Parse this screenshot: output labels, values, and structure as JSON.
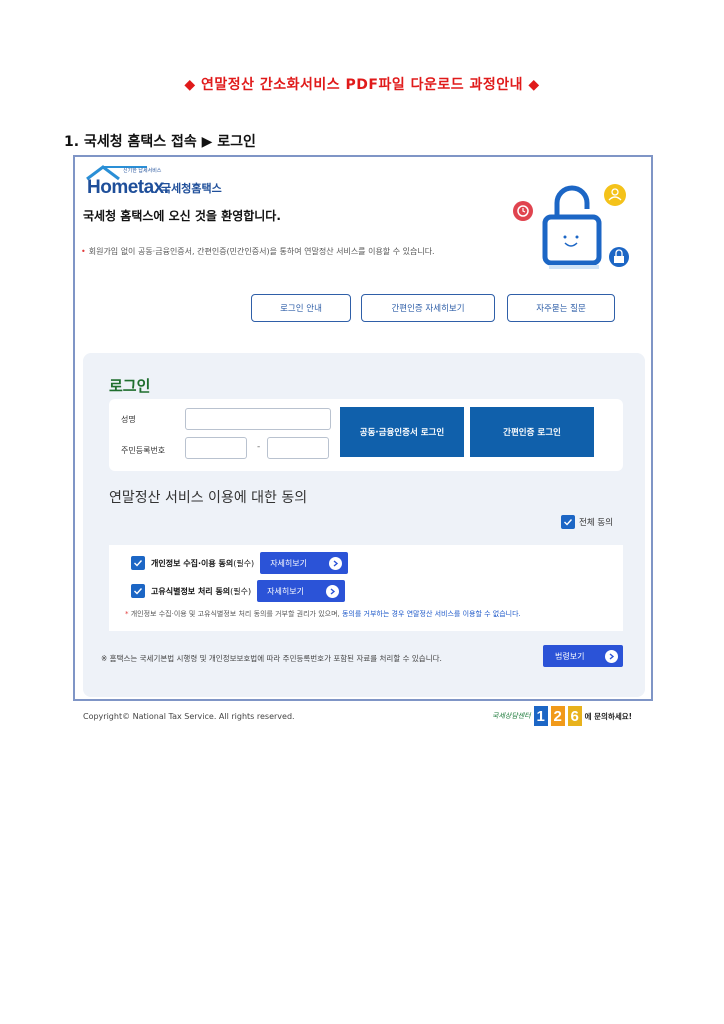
{
  "document": {
    "title": "◆ 연말정산 간소화서비스 PDF파일 다운로드 과정안내 ◆",
    "step_heading": "1. 국세청 홈택스 접속 ▶ 로그인"
  },
  "screen": {
    "logo": {
      "brand": "Hometax.",
      "tagline": "신기한 납세서비스",
      "korean": "국세청홈택스"
    },
    "welcome": "국세청 홈택스에 오신 것을 환영합니다.",
    "notice": "회원가입 없이 공동·금융인증서, 간편인증(민간인증서)을 통하여 연말정산 서비스를 이용할 수 있습니다.",
    "top_buttons": [
      "로그인 안내",
      "간편인증 자세히보기",
      "자주묻는 질문"
    ],
    "login": {
      "title": "로그인",
      "name_label": "성명",
      "rrn_label": "주민등록번호",
      "rrn_separator": "-",
      "cert_login_button": "공동·금융인증서 로그인",
      "simple_login_button": "간편인증 로그인"
    },
    "consent": {
      "title": "연말정산 서비스 이용에 대한 동의",
      "agree_all": "전체 동의",
      "item1_bold": "개인정보 수집·이용 동의",
      "item1_suffix": "(필수)",
      "item2_bold": "고유식별정보 처리 동의",
      "item2_suffix": "(필수)",
      "detail_button": "자세히보기",
      "fine_print_1": "개인정보 수집·이용 및 고유식별정보 처리 동의를 거부할 권리가 있으며, ",
      "fine_print_2": "동의를 거부하는 경우 연말정산 서비스를 이용할 수 없습니다."
    },
    "law_note": "※ 홈택스는 국세기본법 시행령 및 개인정보보호법에 따라 주민등록번호가 포함된 자료를 처리할 수 있습니다.",
    "law_button": "법령보기"
  },
  "footer": {
    "copyright": "Copyright© National Tax Service. All rights reserved.",
    "helpline_script": "국세상담센터",
    "helpline_digits": [
      "1",
      "2",
      "6"
    ],
    "helpline_tail": "에 문의하세요!"
  },
  "colors": {
    "title_red": "#e01a1a",
    "frame_border": "#7f95c6",
    "primary_blue": "#1060ab",
    "detail_blue": "#2b53d7",
    "login_green": "#1f6e2e"
  }
}
